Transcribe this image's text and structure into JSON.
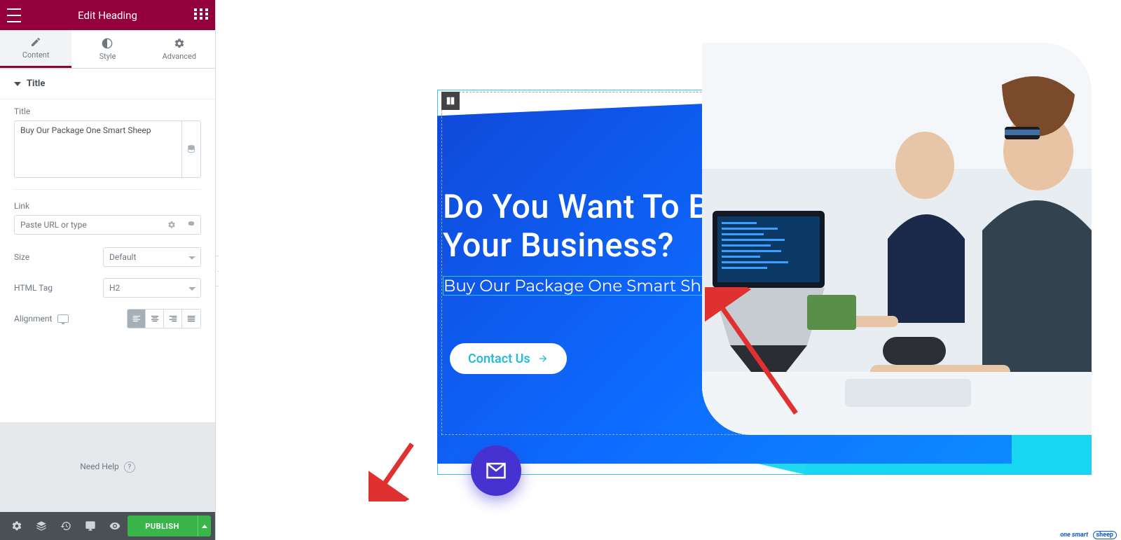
{
  "panel": {
    "title": "Edit Heading",
    "tabs": {
      "content": "Content",
      "style": "Style",
      "advanced": "Advanced"
    },
    "section_title": "Title",
    "title_label": "Title",
    "title_value": "Buy Our Package One Smart Sheep",
    "link_label": "Link",
    "link_placeholder": "Paste URL or type",
    "size_label": "Size",
    "size_value": "Default",
    "tag_label": "HTML Tag",
    "tag_value": "H2",
    "align_label": "Alignment",
    "help": "Need Help"
  },
  "footer": {
    "publish": "PUBLISH"
  },
  "canvas": {
    "hero_line1": "Do You Want To Boost",
    "hero_line2": "Your Business?",
    "heading_text": "Buy Our Package One Smart Sheep",
    "contact": "Contact Us"
  },
  "watermark": {
    "brand": "one smart",
    "tag": "sheep"
  }
}
